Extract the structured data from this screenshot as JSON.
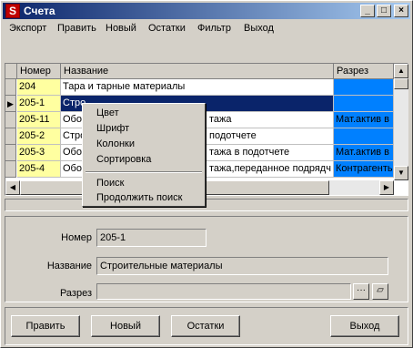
{
  "window": {
    "title": "Счета",
    "app_icon_glyph": "S",
    "minimize": "_",
    "maximize": "□",
    "close": "×"
  },
  "menu": [
    "Экспорт",
    "Править",
    "Новый",
    "Остатки",
    "Фильтр",
    "Выход"
  ],
  "grid": {
    "columns": [
      "Номер",
      "Название",
      "Разрез"
    ],
    "rows": [
      {
        "num": "204",
        "name": "Тара и тарные материалы",
        "sec": ""
      },
      {
        "num": "205-1",
        "name": "Стро",
        "sec": ""
      },
      {
        "num": "205-11",
        "name": "Обор",
        "name_tail": "тажа",
        "sec": "Мат.актив в"
      },
      {
        "num": "205-2",
        "name": "Стро",
        "name_tail": "подотчете",
        "sec": ""
      },
      {
        "num": "205-3",
        "name": "Обор",
        "name_tail": "тажа в подотчете",
        "sec": "Мат.актив в"
      },
      {
        "num": "205-4",
        "name": "Обор",
        "name_tail": "тажа,переданное подрядч",
        "sec": "Контрагенты"
      }
    ],
    "current_row_marker": "▶",
    "scroll_up": "▲",
    "scroll_down": "▼",
    "scroll_left": "◀",
    "scroll_right": "▶"
  },
  "context_menu": [
    "Цвет",
    "Шрифт",
    "Колонки",
    "Сортировка",
    "Поиск",
    "Продолжить поиск"
  ],
  "details": {
    "number_label": "Номер",
    "number_value": "205-1",
    "name_label": "Название",
    "name_value": "Строительные материалы",
    "section_label": "Разрез",
    "section_value": "",
    "browse_glyph": "···",
    "clear_glyph": "▱"
  },
  "buttons": {
    "edit": "Править",
    "new": "Новый",
    "balances": "Остатки",
    "exit": "Выход"
  },
  "colors": {
    "number_col": "#ffffa0",
    "section_col": "#0080ff",
    "selection": "#0a246a"
  }
}
